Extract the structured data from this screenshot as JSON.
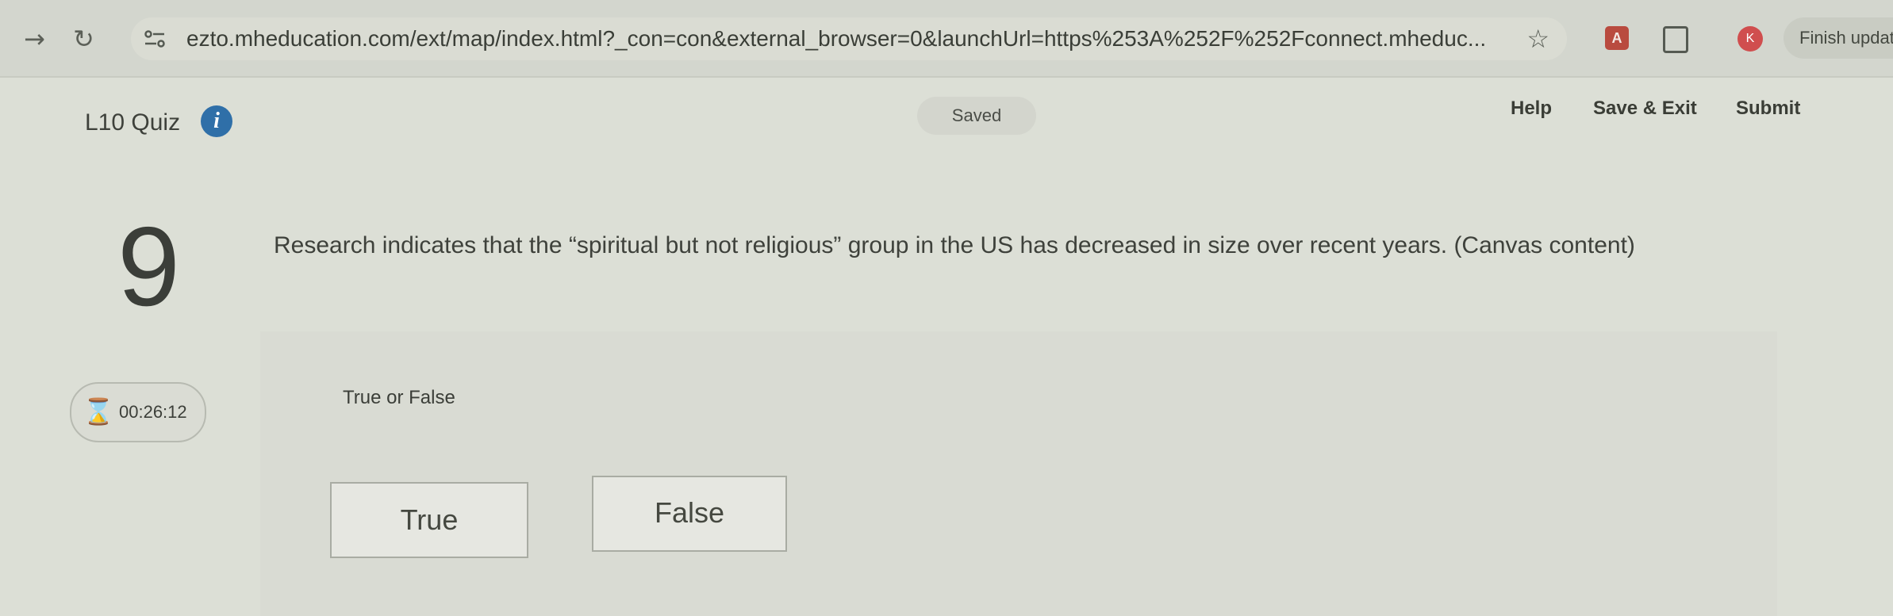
{
  "browser": {
    "back_icon": "arrow-right-icon",
    "reload_icon": "reload-icon",
    "url": "ezto.mheducation.com/ext/map/index.html?_con=con&external_browser=0&launchUrl=https%253A%252F%252Fconnect.mheduc...",
    "bookmark_icon": "star-icon",
    "pdf_extension_label": "A",
    "profile_label": "K",
    "update_button": "Finish updat"
  },
  "header": {
    "quiz_title": "L10 Quiz",
    "info_icon_label": "i",
    "saved_status": "Saved",
    "help_label": "Help",
    "save_exit_label": "Save & Exit",
    "submit_label": "Submit"
  },
  "question": {
    "number": "9",
    "text": "Research indicates that the “spiritual but not religious” group in the US  has decreased in size over recent years. (Canvas content)"
  },
  "timer": {
    "icon": "hourglass-icon",
    "value": "00:26:12"
  },
  "answer": {
    "type_label": "True or False",
    "choices": [
      "True",
      "False"
    ]
  },
  "colors": {
    "info_icon": "#2f6fa8",
    "background": "#dcdfd6"
  }
}
